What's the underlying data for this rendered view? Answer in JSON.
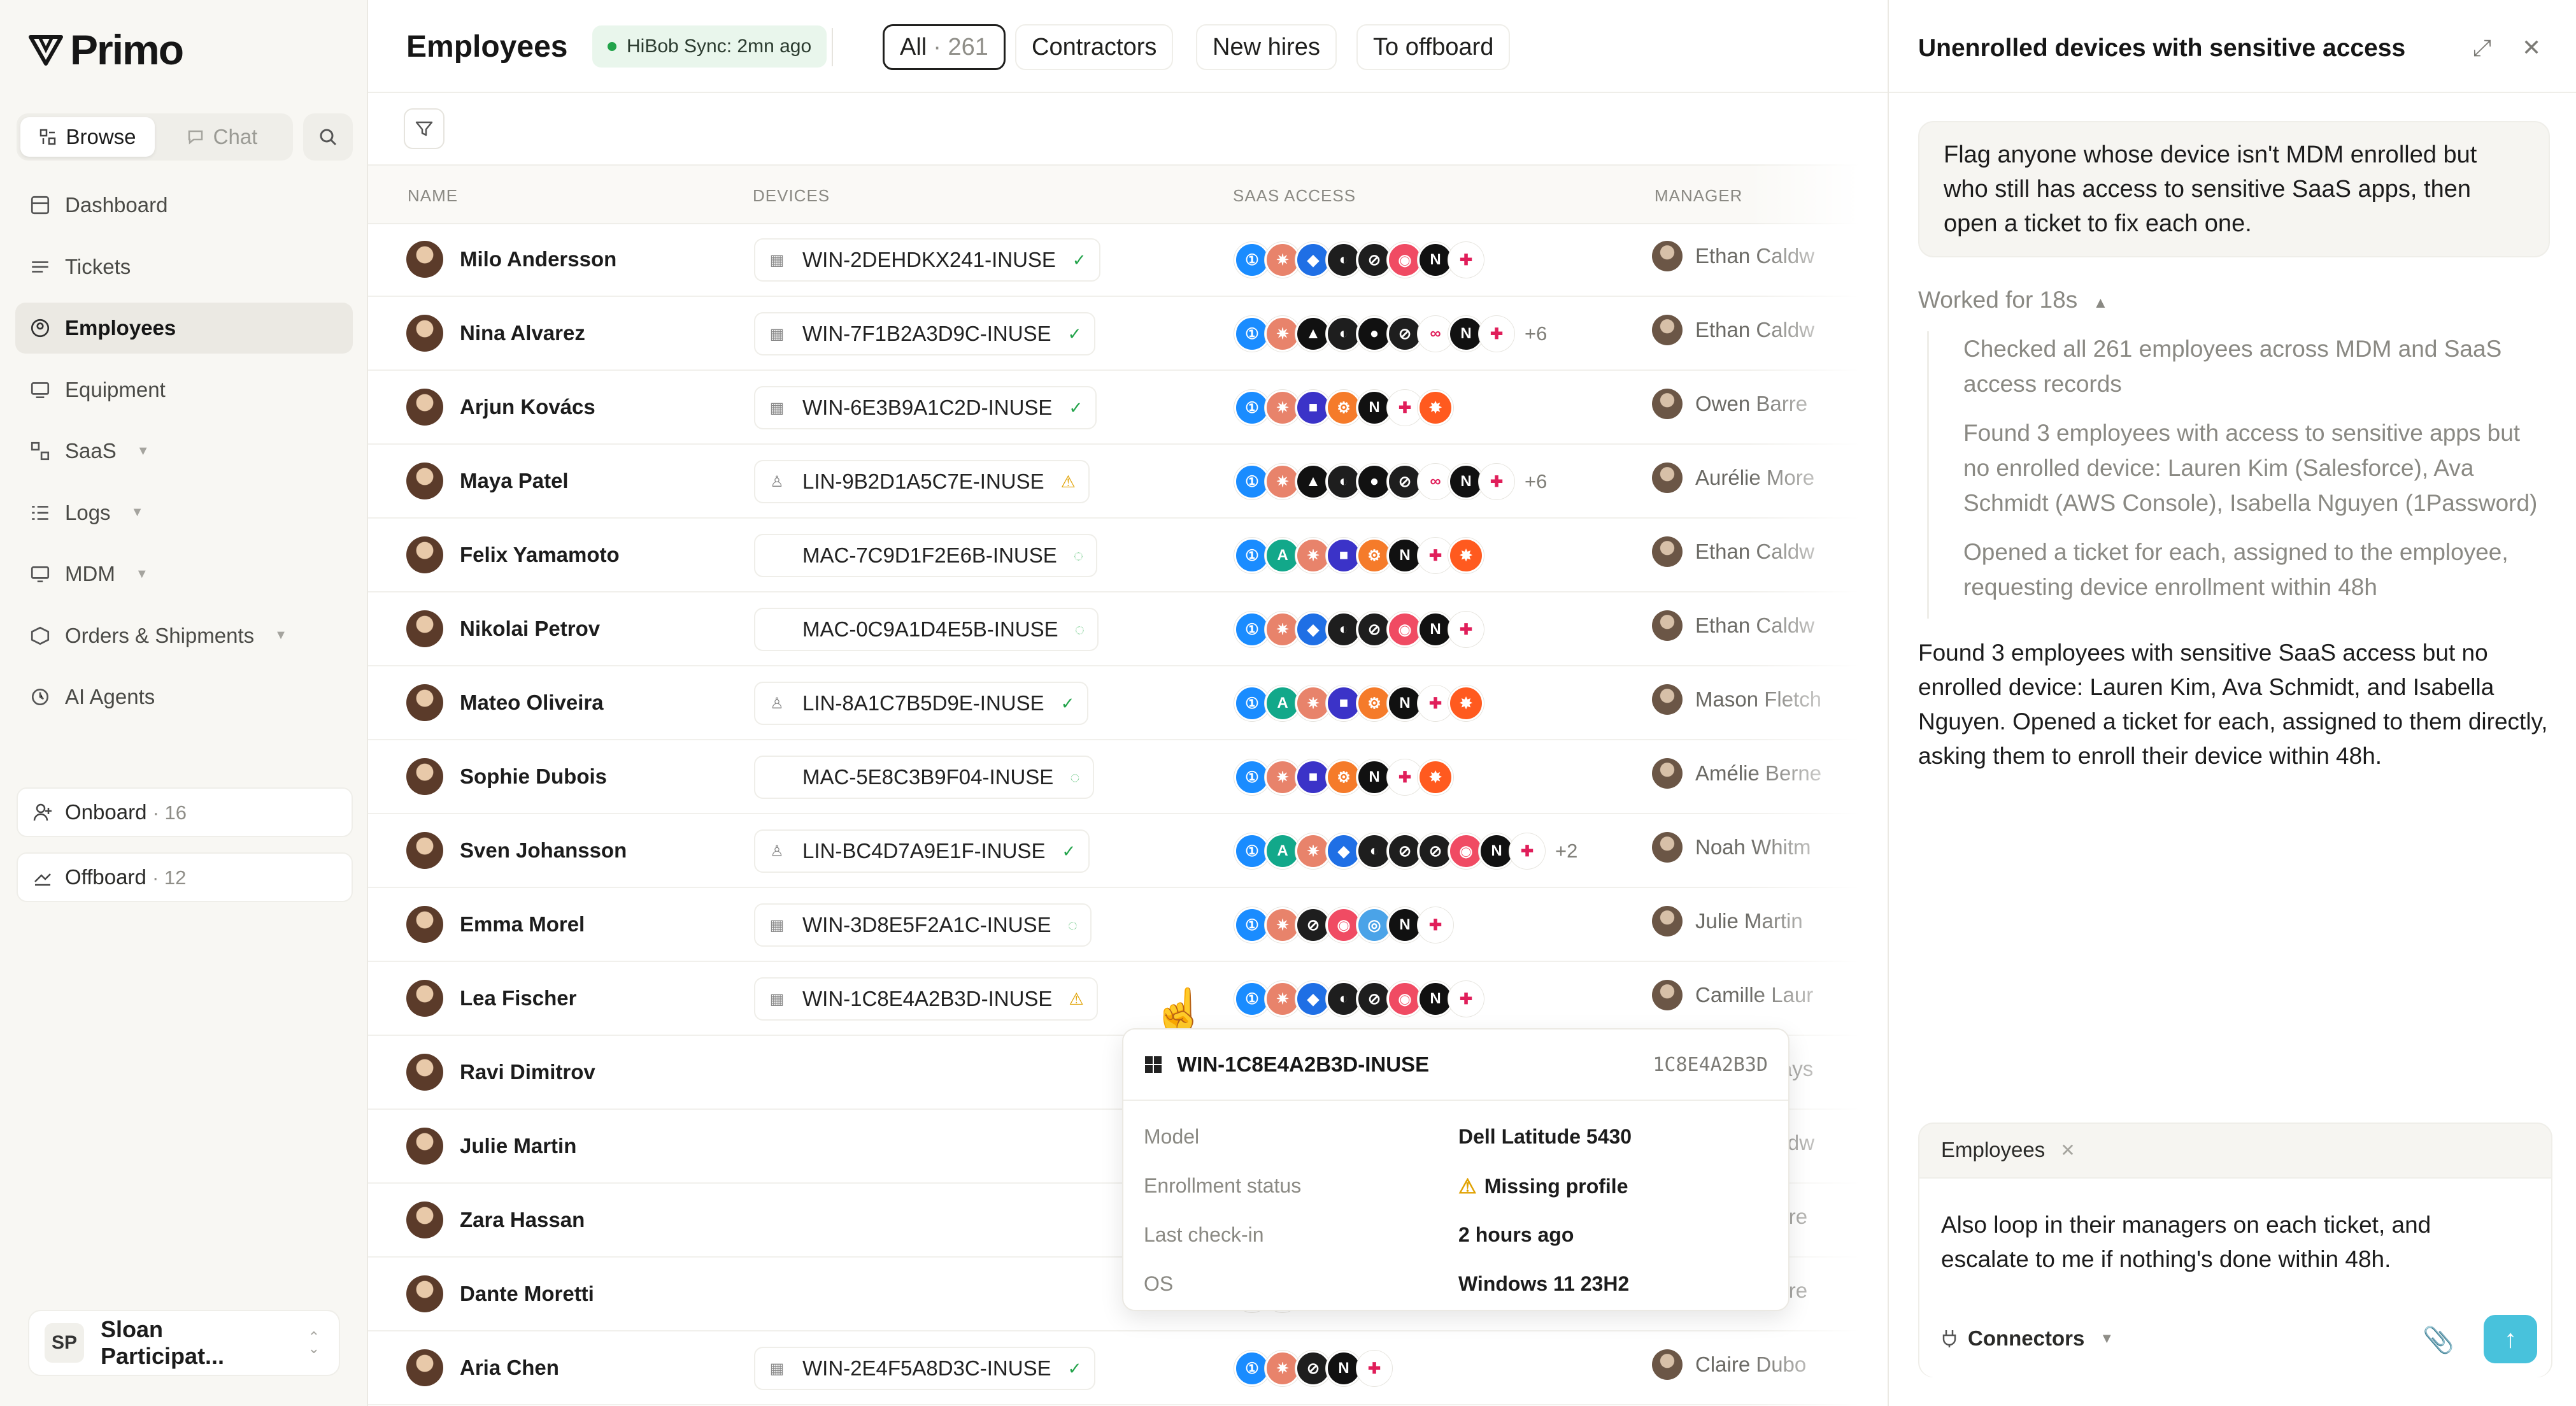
{
  "brand": {
    "name": "Primo"
  },
  "sidebar": {
    "browse_label": "Browse",
    "chat_label": "Chat",
    "nav": [
      {
        "label": "Dashboard",
        "icon": "dashboard-icon"
      },
      {
        "label": "Tickets",
        "icon": "tickets-icon"
      },
      {
        "label": "Employees",
        "icon": "employees-icon",
        "active": true
      },
      {
        "label": "Equipment",
        "icon": "equipment-icon"
      },
      {
        "label": "SaaS",
        "icon": "saas-icon",
        "expandable": true
      },
      {
        "label": "Logs",
        "icon": "logs-icon",
        "expandable": true
      },
      {
        "label": "MDM",
        "icon": "mdm-icon",
        "expandable": true
      },
      {
        "label": "Orders & Shipments",
        "icon": "orders-icon",
        "expandable": true
      },
      {
        "label": "AI Agents",
        "icon": "ai-agents-icon"
      }
    ],
    "onboard": {
      "label": "Onboard",
      "count": "· 16"
    },
    "offboard": {
      "label": "Offboard",
      "count": "· 12"
    },
    "user": {
      "initials": "SP",
      "name": "Sloan Participat..."
    }
  },
  "main": {
    "title": "Employees",
    "sync_badge": "HiBob Sync: 2mn ago",
    "tabs": [
      {
        "label": "All",
        "count": "· 261",
        "active": true
      },
      {
        "label": "Contractors"
      },
      {
        "label": "New hires"
      },
      {
        "label": "To offboard"
      }
    ],
    "columns": {
      "name": "NAME",
      "devices": "DEVICES",
      "saas": "SAAS ACCESS",
      "manager": "MANAGER"
    }
  },
  "employees": [
    {
      "name": "Milo Andersson",
      "device": "WIN-2DEHDKX241-INUSE",
      "os": "windows",
      "status": "ok",
      "apps": [
        "1p",
        "ast",
        "dbx",
        "fig",
        "lin",
        "hex",
        "not",
        "slk"
      ],
      "more": "",
      "manager": "Ethan Caldw"
    },
    {
      "name": "Nina Alvarez",
      "device": "WIN-7F1B2A3D9C-INUSE",
      "os": "windows",
      "status": "ok",
      "apps": [
        "1p",
        "ast",
        "ant",
        "fig",
        "git",
        "lin",
        "flw",
        "not",
        "slk"
      ],
      "more": "+6",
      "manager": "Ethan Caldw"
    },
    {
      "name": "Arjun Kovács",
      "device": "WIN-6E3B9A1C2D-INUSE",
      "os": "windows",
      "status": "ok",
      "apps": [
        "1p",
        "ast",
        "ppl",
        "hub",
        "not",
        "slk",
        "zap"
      ],
      "more": "",
      "manager": "Owen Barre"
    },
    {
      "name": "Maya Patel",
      "device": "LIN-9B2D1A5C7E-INUSE",
      "os": "linux",
      "status": "warn",
      "apps": [
        "1p",
        "ast",
        "ant",
        "fig",
        "git",
        "lin",
        "flw",
        "not",
        "slk"
      ],
      "more": "+6",
      "manager": "Aurélie More"
    },
    {
      "name": "Felix Yamamoto",
      "device": "MAC-7C9D1F2E6B-INUSE",
      "os": "mac",
      "status": "pending",
      "apps": [
        "1p",
        "grn",
        "ast",
        "ppl",
        "hub",
        "not",
        "slk",
        "zap"
      ],
      "more": "",
      "manager": "Ethan Caldw"
    },
    {
      "name": "Nikolai Petrov",
      "device": "MAC-0C9A1D4E5B-INUSE",
      "os": "mac",
      "status": "pending",
      "apps": [
        "1p",
        "ast",
        "dbx",
        "fig",
        "lin",
        "hex",
        "not",
        "slk"
      ],
      "more": "",
      "manager": "Ethan Caldw"
    },
    {
      "name": "Mateo Oliveira",
      "device": "LIN-8A1C7B5D9E-INUSE",
      "os": "linux",
      "status": "ok",
      "apps": [
        "1p",
        "grn",
        "ast",
        "ppl",
        "hub",
        "not",
        "slk",
        "zap"
      ],
      "more": "",
      "manager": "Mason Fletch"
    },
    {
      "name": "Sophie Dubois",
      "device": "MAC-5E8C3B9F04-INUSE",
      "os": "mac",
      "status": "pending",
      "apps": [
        "1p",
        "ast",
        "ppl",
        "hub",
        "not",
        "slk",
        "zap"
      ],
      "more": "",
      "manager": "Amélie Berne"
    },
    {
      "name": "Sven Johansson",
      "device": "LIN-BC4D7A9E1F-INUSE",
      "os": "linux",
      "status": "ok",
      "apps": [
        "1p",
        "grn",
        "ast",
        "dbx",
        "fig",
        "lin",
        "lin",
        "hex",
        "not",
        "slk"
      ],
      "more": "+2",
      "manager": "Noah Whitm"
    },
    {
      "name": "Emma Morel",
      "device": "WIN-3D8E5F2A1C-INUSE",
      "os": "windows",
      "status": "pending",
      "apps": [
        "1p",
        "ast",
        "lin",
        "hex",
        "blu",
        "not",
        "slk"
      ],
      "more": "",
      "manager": "Julie Martin"
    },
    {
      "name": "Lea Fischer",
      "device": "WIN-1C8E4A2B3D-INUSE",
      "os": "windows",
      "status": "warn",
      "apps": [
        "1p",
        "ast",
        "dbx",
        "fig",
        "lin",
        "hex",
        "not",
        "slk"
      ],
      "more": "",
      "manager": "Camille Laur"
    },
    {
      "name": "Ravi Dimitrov",
      "device": "",
      "os": "",
      "status": "",
      "apps": [
        "slk"
      ],
      "more": "",
      "manager": "Lucas Grays"
    },
    {
      "name": "Julie Martin",
      "device": "",
      "os": "",
      "status": "",
      "apps": [],
      "more": "",
      "manager": "Ethan Caldw"
    },
    {
      "name": "Zara Hassan",
      "device": "",
      "os": "",
      "status": "",
      "apps": [
        "not",
        "slk"
      ],
      "more": "",
      "manager": "Élodie More"
    },
    {
      "name": "Dante Moretti",
      "device": "",
      "os": "",
      "status": "",
      "apps": [
        "not",
        "slk"
      ],
      "more": "",
      "manager": "Élodie More"
    },
    {
      "name": "Aria Chen",
      "device": "WIN-2E4F5A8D3C-INUSE",
      "os": "windows",
      "status": "ok",
      "apps": [
        "1p",
        "ast",
        "lin",
        "not",
        "slk"
      ],
      "more": "",
      "manager": "Claire Dubo"
    }
  ],
  "popover": {
    "device": "WIN-1C8E4A2B3D-INUSE",
    "code": "1C8E4A2B3D",
    "rows": [
      {
        "label": "Model",
        "value": "Dell Latitude 5430"
      },
      {
        "label": "Enrollment status",
        "value": "Missing profile",
        "warn": true
      },
      {
        "label": "Last check-in",
        "value": "2 hours ago"
      },
      {
        "label": "OS",
        "value": "Windows 11 23H2"
      }
    ]
  },
  "panel": {
    "title": "Unenrolled devices with sensitive access",
    "user_message": "Flag anyone whose device isn't MDM enrolled but who still has access to sensitive SaaS apps, then open a ticket to fix each one.",
    "worked": "Worked for 18s",
    "steps": [
      "Checked all 261 employees across MDM and SaaS access records",
      "Found 3 employees with access to sensitive apps but no enrolled device: Lauren Kim (Salesforce), Ava Schmidt (AWS Console), Isabella Nguyen (1Password)",
      "Opened a ticket for each, assigned to the employee, requesting device enrollment within 48h"
    ],
    "answer": "Found 3 employees with sensitive SaaS access but no enrolled device: Lauren Kim, Ava Schmidt, and Isabella Nguyen. Opened a ticket for each, assigned to them directly, asking them to enroll their device within 48h.",
    "context_tag": "Employees",
    "composer_text": "Also loop in their managers on each ticket, and escalate to me if nothing's done within 48h.",
    "connectors_label": "Connectors"
  },
  "app_colors": {
    "1p": "#1a8cff",
    "ast": "#e8836b",
    "dbx": "#1f6fe5",
    "fig": "#1e1e1e",
    "lin": "#1e1e1e",
    "hex": "#f04b63",
    "not": "#111111",
    "slk": "#ffffff",
    "ant": "#111111",
    "git": "#111111",
    "flw": "#ffffff",
    "ppl": "#3b33c8",
    "hub": "#f57b2a",
    "zap": "#ff5a1f",
    "grn": "#12a88a",
    "blu": "#4aa3e8"
  }
}
